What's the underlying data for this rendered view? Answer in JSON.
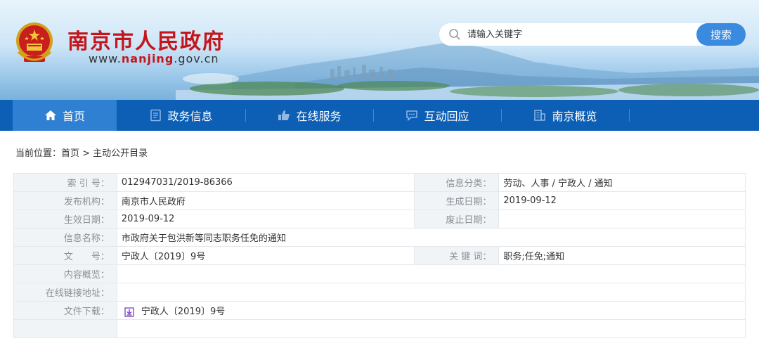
{
  "header": {
    "site_title": "南京市人民政府",
    "url_prefix": "www.",
    "url_domain": "nanjing",
    "url_suffix": ".gov.cn",
    "search_placeholder": "请输入关键字",
    "search_button": "搜索"
  },
  "nav": {
    "items": [
      {
        "label": "首页",
        "icon": "home-icon",
        "active": true
      },
      {
        "label": "政务信息",
        "icon": "document-icon"
      },
      {
        "label": "在线服务",
        "icon": "thumbs-up-icon"
      },
      {
        "label": "互动回应",
        "icon": "chat-icon"
      },
      {
        "label": "南京概览",
        "icon": "building-icon"
      }
    ]
  },
  "breadcrumb": "当前位置：首页 > 主动公开目录",
  "info": {
    "index_label": "索 引 号：",
    "index_value": "012947031/2019-86366",
    "category_label": "信息分类：",
    "category_value": "劳动、人事 / 宁政人 / 通知",
    "publisher_label": "发布机构：",
    "publisher_value": "南京市人民政府",
    "created_label": "生成日期：",
    "created_value": "2019-09-12",
    "effective_label": "生效日期：",
    "effective_value": "2019-09-12",
    "expiry_label": "废止日期：",
    "expiry_value": "",
    "name_label": "信息名称：",
    "name_value": "市政府关于包洪新等同志职务任免的通知",
    "docno_label": "文　　号：",
    "docno_value": "宁政人〔2019〕9号",
    "keywords_label": "关 键 词：",
    "keywords_value": "职务;任免;通知",
    "summary_label": "内容概览：",
    "summary_value": "",
    "link_label": "在线链接地址：",
    "link_value": "",
    "download_label": "文件下载：",
    "download_value": "宁政人〔2019〕9号"
  },
  "colors": {
    "title_red": "#c4151c",
    "nav_blue": "#0d5fb5",
    "nav_active": "#2f80d3",
    "search_button": "#3a8be0"
  }
}
